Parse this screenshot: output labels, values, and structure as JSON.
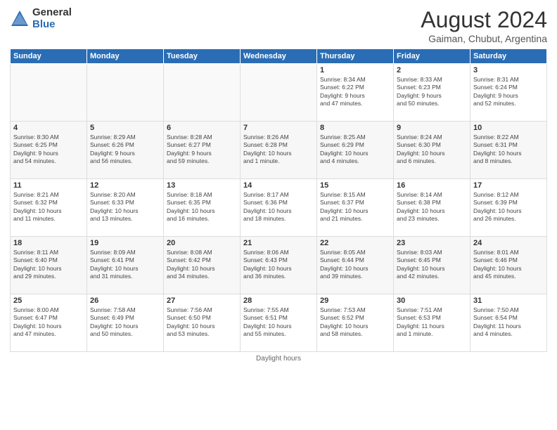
{
  "header": {
    "logo_general": "General",
    "logo_blue": "Blue",
    "month_year": "August 2024",
    "location": "Gaiman, Chubut, Argentina"
  },
  "days_of_week": [
    "Sunday",
    "Monday",
    "Tuesday",
    "Wednesday",
    "Thursday",
    "Friday",
    "Saturday"
  ],
  "weeks": [
    [
      {
        "day": "",
        "info": ""
      },
      {
        "day": "",
        "info": ""
      },
      {
        "day": "",
        "info": ""
      },
      {
        "day": "",
        "info": ""
      },
      {
        "day": "1",
        "info": "Sunrise: 8:34 AM\nSunset: 6:22 PM\nDaylight: 9 hours\nand 47 minutes."
      },
      {
        "day": "2",
        "info": "Sunrise: 8:33 AM\nSunset: 6:23 PM\nDaylight: 9 hours\nand 50 minutes."
      },
      {
        "day": "3",
        "info": "Sunrise: 8:31 AM\nSunset: 6:24 PM\nDaylight: 9 hours\nand 52 minutes."
      }
    ],
    [
      {
        "day": "4",
        "info": "Sunrise: 8:30 AM\nSunset: 6:25 PM\nDaylight: 9 hours\nand 54 minutes."
      },
      {
        "day": "5",
        "info": "Sunrise: 8:29 AM\nSunset: 6:26 PM\nDaylight: 9 hours\nand 56 minutes."
      },
      {
        "day": "6",
        "info": "Sunrise: 8:28 AM\nSunset: 6:27 PM\nDaylight: 9 hours\nand 59 minutes."
      },
      {
        "day": "7",
        "info": "Sunrise: 8:26 AM\nSunset: 6:28 PM\nDaylight: 10 hours\nand 1 minute."
      },
      {
        "day": "8",
        "info": "Sunrise: 8:25 AM\nSunset: 6:29 PM\nDaylight: 10 hours\nand 4 minutes."
      },
      {
        "day": "9",
        "info": "Sunrise: 8:24 AM\nSunset: 6:30 PM\nDaylight: 10 hours\nand 6 minutes."
      },
      {
        "day": "10",
        "info": "Sunrise: 8:22 AM\nSunset: 6:31 PM\nDaylight: 10 hours\nand 8 minutes."
      }
    ],
    [
      {
        "day": "11",
        "info": "Sunrise: 8:21 AM\nSunset: 6:32 PM\nDaylight: 10 hours\nand 11 minutes."
      },
      {
        "day": "12",
        "info": "Sunrise: 8:20 AM\nSunset: 6:33 PM\nDaylight: 10 hours\nand 13 minutes."
      },
      {
        "day": "13",
        "info": "Sunrise: 8:18 AM\nSunset: 6:35 PM\nDaylight: 10 hours\nand 16 minutes."
      },
      {
        "day": "14",
        "info": "Sunrise: 8:17 AM\nSunset: 6:36 PM\nDaylight: 10 hours\nand 18 minutes."
      },
      {
        "day": "15",
        "info": "Sunrise: 8:15 AM\nSunset: 6:37 PM\nDaylight: 10 hours\nand 21 minutes."
      },
      {
        "day": "16",
        "info": "Sunrise: 8:14 AM\nSunset: 6:38 PM\nDaylight: 10 hours\nand 23 minutes."
      },
      {
        "day": "17",
        "info": "Sunrise: 8:12 AM\nSunset: 6:39 PM\nDaylight: 10 hours\nand 26 minutes."
      }
    ],
    [
      {
        "day": "18",
        "info": "Sunrise: 8:11 AM\nSunset: 6:40 PM\nDaylight: 10 hours\nand 29 minutes."
      },
      {
        "day": "19",
        "info": "Sunrise: 8:09 AM\nSunset: 6:41 PM\nDaylight: 10 hours\nand 31 minutes."
      },
      {
        "day": "20",
        "info": "Sunrise: 8:08 AM\nSunset: 6:42 PM\nDaylight: 10 hours\nand 34 minutes."
      },
      {
        "day": "21",
        "info": "Sunrise: 8:06 AM\nSunset: 6:43 PM\nDaylight: 10 hours\nand 36 minutes."
      },
      {
        "day": "22",
        "info": "Sunrise: 8:05 AM\nSunset: 6:44 PM\nDaylight: 10 hours\nand 39 minutes."
      },
      {
        "day": "23",
        "info": "Sunrise: 8:03 AM\nSunset: 6:45 PM\nDaylight: 10 hours\nand 42 minutes."
      },
      {
        "day": "24",
        "info": "Sunrise: 8:01 AM\nSunset: 6:46 PM\nDaylight: 10 hours\nand 45 minutes."
      }
    ],
    [
      {
        "day": "25",
        "info": "Sunrise: 8:00 AM\nSunset: 6:47 PM\nDaylight: 10 hours\nand 47 minutes."
      },
      {
        "day": "26",
        "info": "Sunrise: 7:58 AM\nSunset: 6:49 PM\nDaylight: 10 hours\nand 50 minutes."
      },
      {
        "day": "27",
        "info": "Sunrise: 7:56 AM\nSunset: 6:50 PM\nDaylight: 10 hours\nand 53 minutes."
      },
      {
        "day": "28",
        "info": "Sunrise: 7:55 AM\nSunset: 6:51 PM\nDaylight: 10 hours\nand 55 minutes."
      },
      {
        "day": "29",
        "info": "Sunrise: 7:53 AM\nSunset: 6:52 PM\nDaylight: 10 hours\nand 58 minutes."
      },
      {
        "day": "30",
        "info": "Sunrise: 7:51 AM\nSunset: 6:53 PM\nDaylight: 11 hours\nand 1 minute."
      },
      {
        "day": "31",
        "info": "Sunrise: 7:50 AM\nSunset: 6:54 PM\nDaylight: 11 hours\nand 4 minutes."
      }
    ]
  ],
  "footer": {
    "note": "Daylight hours"
  }
}
